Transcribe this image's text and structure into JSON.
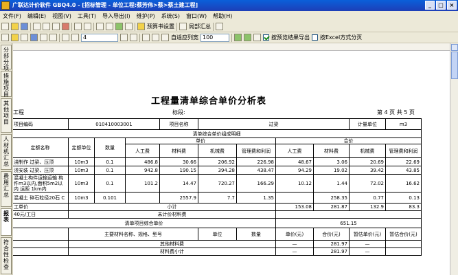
{
  "window": {
    "title": "广联达计价软件 GBQ4.0 - [招标管理 - 单位工程:蔡芳伟>蔡>蔡土建工程]"
  },
  "menu": [
    "文件(F)",
    "编辑(E)",
    "视图(V)",
    "工具(T)",
    "导入导出(I)",
    "维护(P)",
    "系统(S)",
    "窗口(W)",
    "帮助(H)"
  ],
  "toolbar1": {
    "set_price_book": "预算书设置",
    "partial_summary": "局部汇总"
  },
  "toolbar2": {
    "page_value": "4",
    "fit_width": "自适应列宽",
    "zoom": "100",
    "export_by_preview": "按预览结果导出",
    "export_excel": "按Excel方式分页"
  },
  "sidetabs": [
    "分部分项",
    "措施项目",
    "其他项目",
    "人材机汇总",
    "费用汇总",
    "报表",
    "符合性检查"
  ],
  "report": {
    "title": "工程量清单综合单价分析表",
    "project_label": "工程",
    "section_label": "标段:",
    "page_info": "第 4 页  共 5 页",
    "code_label": "项目编码",
    "code": "010410003001",
    "name_label": "项目名称",
    "name": "过梁",
    "unit_label": "计量单位",
    "unit": "m3",
    "composition_title": "清单综合单价组成明细",
    "col_quota_name": "定额名称",
    "col_quota_unit": "定额单位",
    "col_qty": "数量",
    "group_unit_price": "单价",
    "group_total": "合价",
    "col_labor": "人工费",
    "col_material": "材料费",
    "col_machine": "机械费",
    "col_mgmt": "管理费和利润",
    "rows": [
      {
        "name": "浇制作 过梁、压顶",
        "unit": "10m3",
        "qty": "0.1",
        "p1": "486.8",
        "p2": "30.66",
        "p3": "206.92",
        "p4": "226.98",
        "t1": "48.67",
        "t2": "3.06",
        "t3": "20.69",
        "t4": "22.69"
      },
      {
        "name": "浇安装 过梁、压顶",
        "unit": "10m3",
        "qty": "0.1",
        "p1": "942.8",
        "p2": "190.15",
        "p3": "394.28",
        "p4": "438.47",
        "t1": "94.29",
        "t2": "19.02",
        "t3": "39.42",
        "t4": "43.85"
      },
      {
        "name": "混凝土构件运输运输 构件m3以内,面积5m2以内 运距 1km内",
        "unit": "10m3",
        "qty": "0.1",
        "p1": "101.2",
        "p2": "14.47",
        "p3": "720.27",
        "p4": "166.29",
        "t1": "10.12",
        "t2": "1.44",
        "t3": "72.02",
        "t4": "16.62"
      },
      {
        "name": "混凝土 碎石粒径20石 C",
        "unit": "10m3",
        "qty": "0.101",
        "p1": "",
        "p2": "2557.9",
        "p3": "7.7",
        "p4": "1.35",
        "t1": "",
        "t2": "258.35",
        "t3": "0.77",
        "t4": "0.13"
      }
    ],
    "labor_price_label": "工单价",
    "subtotal_label": "小计",
    "subtotal": {
      "t1": "153.08",
      "t2": "281.87",
      "t3": "132.9",
      "t4": "83.3"
    },
    "labor_rate": "40元/工日",
    "unpriced_label": "未计价材料费",
    "composite_label": "清单项目综合单价",
    "composite_value": "651.15",
    "mat_name_label": "主要材料名称、规格、型号",
    "mat_unit_label": "单位",
    "mat_qty_label": "数量",
    "mat_price_label": "单价(元)",
    "mat_total_label": "合价(元)",
    "mat_est_price_label": "暂估单价(元)",
    "mat_est_total_label": "暂估合价(元)",
    "other_mat_label": "其他材料费",
    "other_mat_dash": "—",
    "other_mat_total": "281.97",
    "other_mat_dash2": "—",
    "mat_subtotal_label": "材料费小计",
    "mat_subtotal_dash": "—",
    "mat_subtotal": "281.97",
    "mat_subtotal_dash2": "—"
  }
}
